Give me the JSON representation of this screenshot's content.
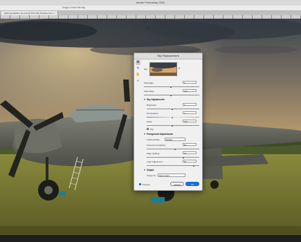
{
  "app": {
    "title": "Adobe Photoshop 2022",
    "options_hint": "Drag to move the sky",
    "document_tab": "lightning-airplane-sky.psd @ 25% (Sky Replacement...)"
  },
  "dialog": {
    "title": "Sky Replacement",
    "sky_label": "Sky:",
    "fields": {
      "shift_edge": {
        "label": "Shift Edge",
        "value": "0",
        "level": 0.5
      },
      "fade_edge": {
        "label": "Fade Edge",
        "value": "100",
        "level": 0.5
      },
      "brightness": {
        "label": "Brightness",
        "value": "0",
        "level": 0.5
      },
      "temperature": {
        "label": "Temperature",
        "value": "0",
        "level": 0.5
      },
      "scale": {
        "label": "Scale",
        "value": "100",
        "level": 0.5
      },
      "foreground_lighting": {
        "label": "Foreground Lighting",
        "value": "50",
        "level": 0.55
      },
      "edge_lighting": {
        "label": "Edge Lighting",
        "value": "70",
        "level": 0.7
      },
      "color_adjustment": {
        "label": "Color Adjustment",
        "value": "90",
        "level": 0.9
      }
    },
    "sky_adjustments_label": "Sky Adjustments",
    "flip_label": "Flip",
    "foreground_adjustments_label": "Foreground Adjustments",
    "lighting_mode_label": "Lighting Mode:",
    "lighting_mode_value": "Multiply",
    "output_label": "Output",
    "output_to_label": "Output To:",
    "output_to_value": "New Layers",
    "preview_label": "Preview",
    "cancel_label": "Cancel",
    "ok_label": "OK"
  },
  "icons": {
    "sky_move_tool": "move-icon",
    "sky_brush_tool": "brush-icon",
    "hand_tool": "hand-icon",
    "zoom_tool": "zoom-icon"
  },
  "colors": {
    "accent": "#1473e6",
    "dialog_bg": "#f0f0f0"
  }
}
